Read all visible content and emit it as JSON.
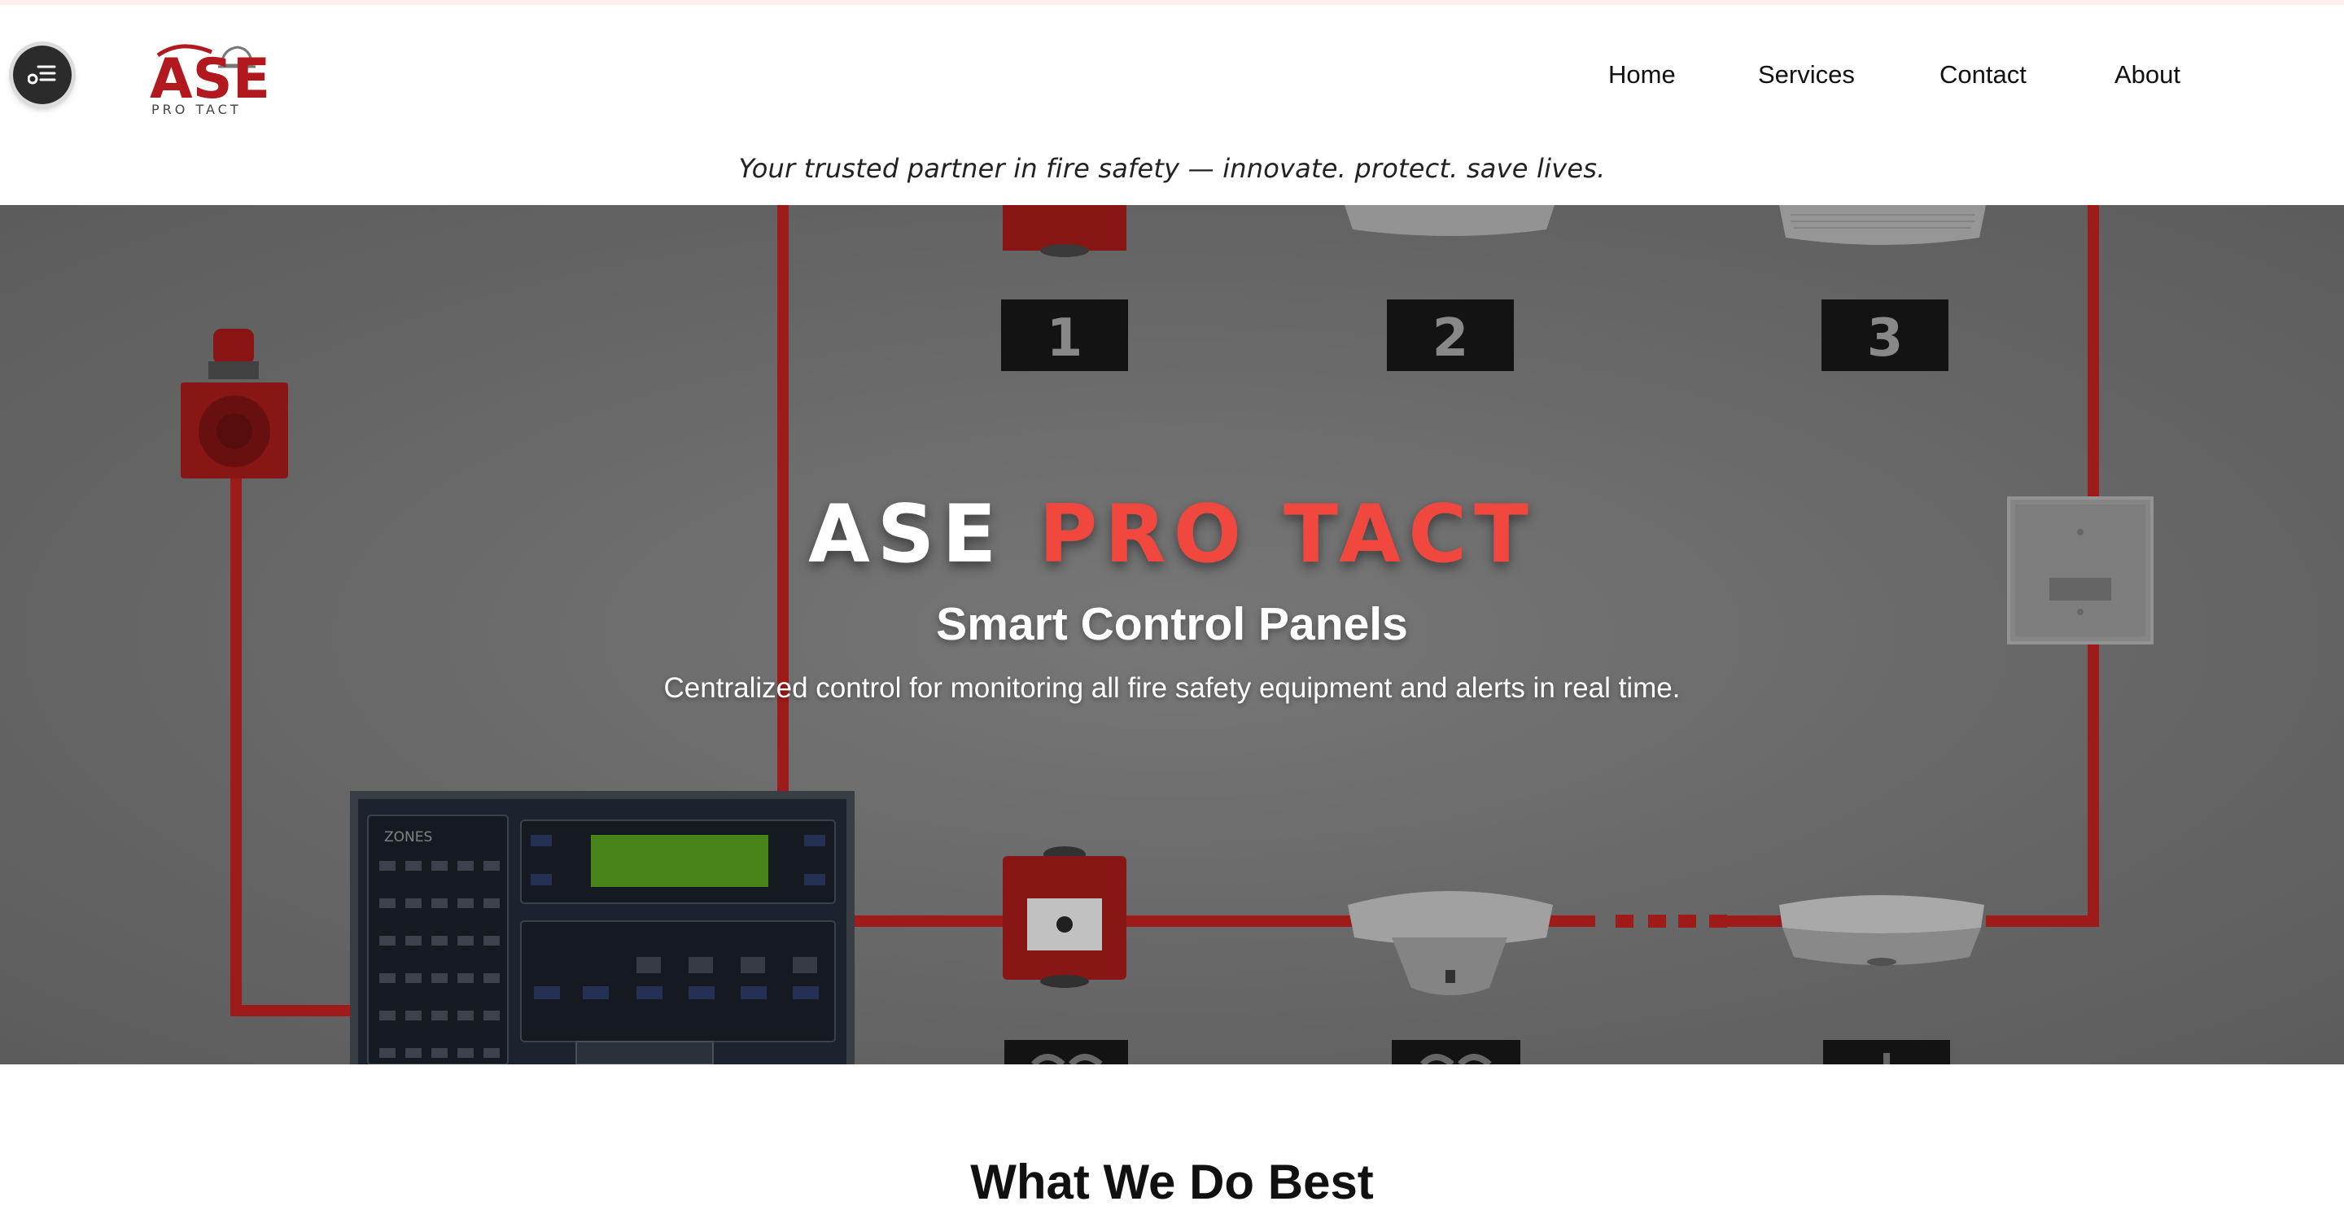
{
  "nav": {
    "items": [
      {
        "label": "Home"
      },
      {
        "label": "Services"
      },
      {
        "label": "Contact"
      },
      {
        "label": "About"
      }
    ]
  },
  "logo": {
    "brand_large": "ASE",
    "brand_small": "PRO TACT"
  },
  "tagline": "Your trusted partner in fire safety — innovate. protect. save lives.",
  "hero": {
    "title_part1": "ASE",
    "title_part2": "PRO TACT",
    "subtitle": "Smart Control Panels",
    "description": "Centralized control for monitoring all fire safety equipment and alerts in real time.",
    "device_labels": [
      "1",
      "2",
      "3"
    ],
    "panel_label": "ZONES"
  },
  "section": {
    "heading": "What We Do Best"
  },
  "colors": {
    "accent": "#f0483e",
    "wire_red": "#c8201e",
    "brand_red": "#b1191f"
  }
}
